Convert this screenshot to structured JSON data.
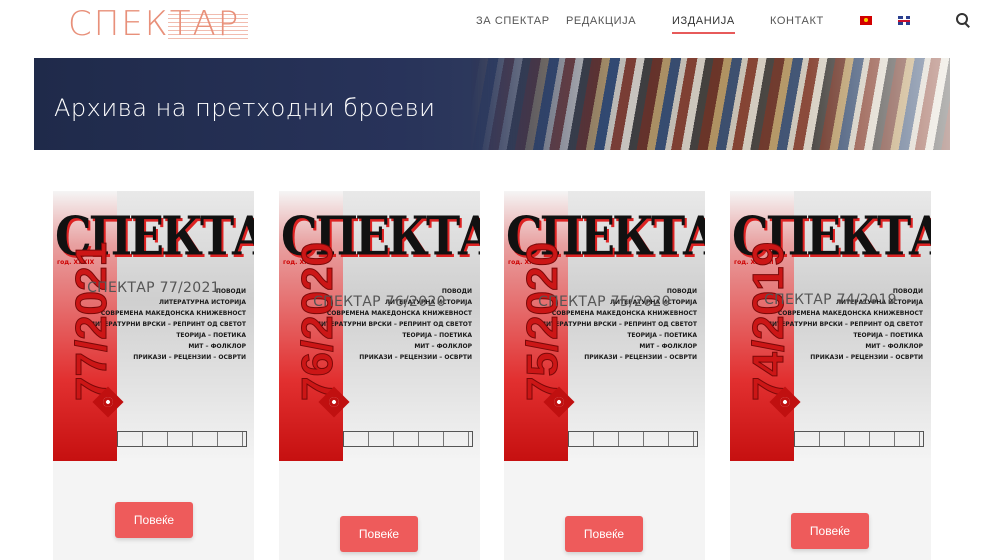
{
  "header": {
    "logo": "СПЕКТАР",
    "nav": [
      {
        "label": "ЗА СПЕКТАР",
        "active": false
      },
      {
        "label": "РЕДАКЦИЈА",
        "active": false
      },
      {
        "label": "ИЗДАНИЈА",
        "active": true
      },
      {
        "label": "КОНТАКТ",
        "active": false
      }
    ],
    "icons": [
      "flag-mk-icon",
      "flag-en-icon",
      "search-icon"
    ]
  },
  "banner": {
    "title": "Архива на претходни броеви"
  },
  "cover_rubrics": [
    "ПОВОДИ",
    "ЛИТЕРАТУРНА ИСТОРИЈА",
    "СОВРЕМЕНА МАКЕДОНСКА КНИЖЕВНОСТ",
    "ЛИТЕРАТУРНИ ВРСКИ – РЕПРИНТ ОД СВЕТОТ",
    "ТЕОРИЈА – ПОЕТИКА",
    "МИТ – ФОЛКЛОР",
    "ПРИКАЗИ – РЕЦЕНЗИИ – ОСВРТИ"
  ],
  "issues": [
    {
      "cover_mast": "СПЕКТАР",
      "cover_year": "год. XXXIX",
      "cover_number": "77/2021",
      "title": "СПЕКТАР 77/2021",
      "button": "Повеќе"
    },
    {
      "cover_mast": "СПЕКТАР",
      "cover_year": "год. XXXVIII",
      "cover_number": "76/2020",
      "title": "СПЕКТАР 76/2020",
      "button": "Повеќе"
    },
    {
      "cover_mast": "СПЕКТАР",
      "cover_year": "год. XXXVIII",
      "cover_number": "75/2020",
      "title": "СПЕКТАР 75/2020",
      "button": "Повеќе"
    },
    {
      "cover_mast": "СПЕКТАР",
      "cover_year": "год. XXXVII",
      "cover_number": "74/2019",
      "title": "СПЕКТАР 74/2019",
      "button": "Повеќе"
    }
  ],
  "colors": {
    "accent": "#ee5b5b",
    "logo": "#e8907a",
    "banner": "#1f2a4a"
  }
}
